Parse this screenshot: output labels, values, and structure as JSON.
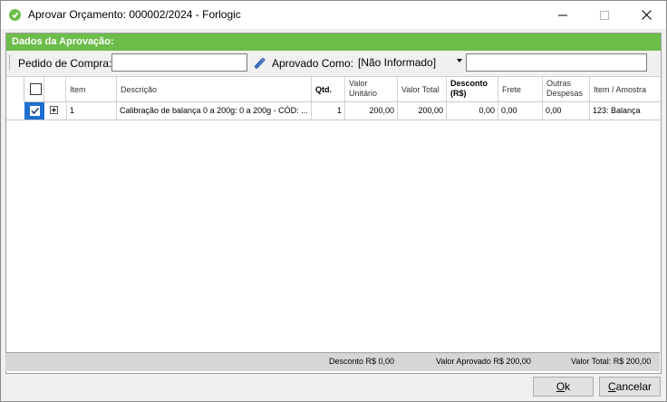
{
  "window": {
    "title": "Aprovar Orçamento: 000002/2024 - Forlogic"
  },
  "colors": {
    "accent": "#6cbd4a",
    "selection": "#1e6fd0"
  },
  "panel": {
    "title": "Dados da Aprovação:"
  },
  "toolbar": {
    "pedido_label": "Pedido de Compra:",
    "pedido_value": "",
    "aprovado_label": "Aprovado Como:",
    "aprovado_value": "[Não Informado]",
    "extra_value": ""
  },
  "grid": {
    "columns": [
      "Item",
      "Descrição",
      "Qtd.",
      "Valor Unitário",
      "Valor Total",
      "Desconto (R$)",
      "Frete",
      "Outras Despesas",
      "Item / Amostra"
    ],
    "rows": [
      {
        "item": "1",
        "descricao": "Calibração de balança 0 a 200g: 0 a 200g - CÓD: ...",
        "qtd": "1",
        "valor_unitario": "200,00",
        "valor_total": "200,00",
        "desconto": "0,00",
        "frete": "0,00",
        "outras_despesas": "0,00",
        "item_amostra": "123: Balança",
        "checked": true
      }
    ]
  },
  "footer": {
    "desconto": "Desconto R$ 0,00",
    "valor_aprovado": "Valor Aprovado R$ 200,00",
    "valor_total": "Valor Total: R$ 200,00"
  },
  "buttons": {
    "ok_mnemonic": "O",
    "ok_rest": "k",
    "cancel_mnemonic": "C",
    "cancel_rest": "ancelar"
  }
}
